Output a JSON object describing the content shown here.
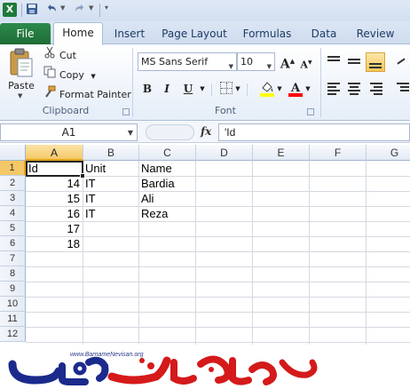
{
  "qat": {
    "app_badge": "X"
  },
  "tabs": {
    "file": "File",
    "items": [
      {
        "id": "home",
        "label": "Home",
        "active": true
      },
      {
        "id": "insert",
        "label": "Insert"
      },
      {
        "id": "page-layout",
        "label": "Page Layout"
      },
      {
        "id": "formulas",
        "label": "Formulas"
      },
      {
        "id": "data",
        "label": "Data"
      },
      {
        "id": "review",
        "label": "Review"
      }
    ]
  },
  "ribbon": {
    "clipboard": {
      "group_label": "Clipboard",
      "paste_label": "Paste",
      "cut_label": "Cut",
      "copy_label": "Copy",
      "format_painter_label": "Format Painter"
    },
    "font": {
      "group_label": "Font",
      "font_name": "MS Sans Serif",
      "font_size": "10",
      "bold": "B",
      "italic": "I",
      "underline": "U",
      "fill_color": "#ffff00",
      "font_color": "#ff0000"
    }
  },
  "formula_bar": {
    "name_box": "A1",
    "fx": "fx",
    "content": "'Id"
  },
  "sheet": {
    "columns": [
      "A",
      "B",
      "C",
      "D",
      "E",
      "F",
      "G"
    ],
    "selected_column": "A",
    "rows": [
      "1",
      "2",
      "3",
      "4",
      "5",
      "6",
      "7",
      "8",
      "9",
      "10",
      "11",
      "12"
    ],
    "selected_row": "1",
    "cells": {
      "A1": "Id",
      "B1": "Unit",
      "C1": "Name",
      "A2": "14",
      "B2": "IT",
      "C2": "Bardia",
      "A3": "15",
      "B3": "IT",
      "C3": "Ali",
      "A4": "16",
      "B4": "IT",
      "C4": "Reza",
      "A5": "17",
      "A6": "18"
    }
  },
  "logo": {
    "url": "www.BarnameNevisan.org"
  },
  "colors": {
    "file_tab": "#1d6b36",
    "selection_header": "#f5c867",
    "logo_blue": "#1b2a8c",
    "logo_red": "#d41a1a"
  }
}
